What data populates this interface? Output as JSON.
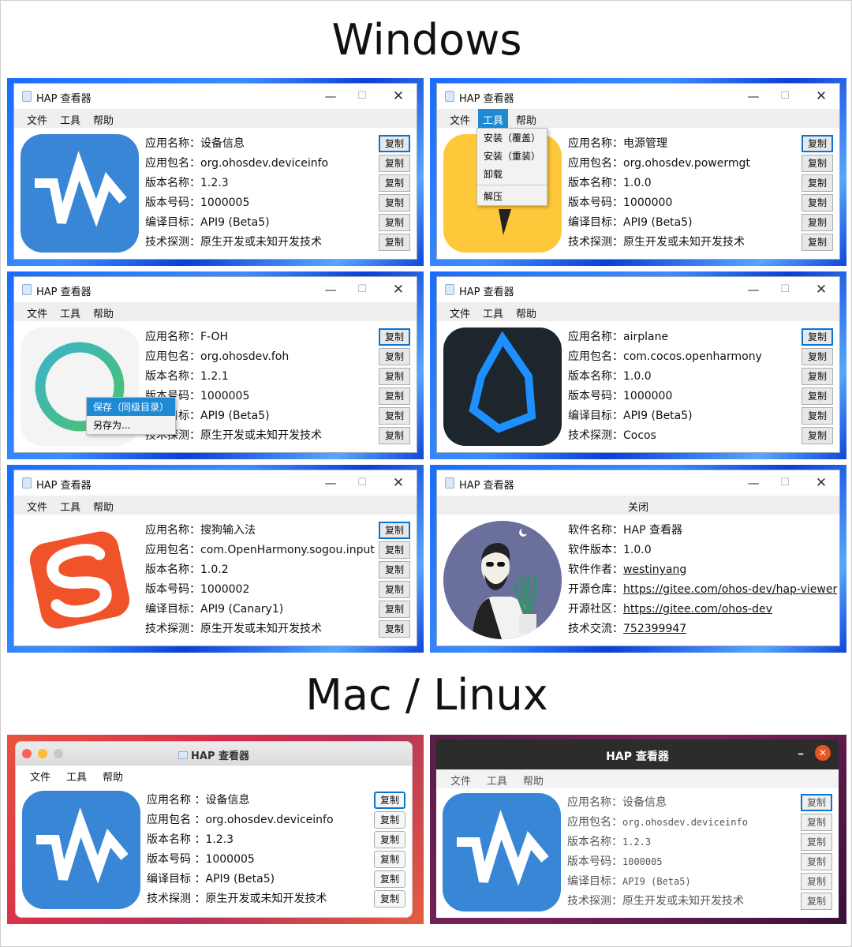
{
  "headings": {
    "windows": "Windows",
    "maclinux": "Mac / Linux"
  },
  "window": {
    "title": "HAP 查看器",
    "menu": [
      "文件",
      "工具",
      "帮助"
    ],
    "copy": "复制"
  },
  "labels": {
    "app_name": "应用名称：",
    "bundle": "应用包名：",
    "version_name": "版本名称：",
    "version_code": "版本号码：",
    "target": "编译目标：",
    "tech": "技术探测：",
    "mac_app_name": "应用名称 ：",
    "mac_bundle": "应用包名 ：",
    "mac_version_name": "版本名称 ：",
    "mac_version_code": "版本号码 ：",
    "mac_target": "编译目标 ：",
    "mac_tech": "技术探测 ："
  },
  "apps": [
    {
      "name": "设备信息",
      "bundle": "org.ohosdev.deviceinfo",
      "version": "1.2.3",
      "code": "1000005",
      "target": "API9 (Beta5)",
      "tech": "原生开发或未知开发技术"
    },
    {
      "name": "电源管理",
      "bundle": "org.ohosdev.powermgt",
      "version": "1.0.0",
      "code": "1000000",
      "target": "API9 (Beta5)",
      "tech": "原生开发或未知开发技术"
    },
    {
      "name": "F-OH",
      "bundle": "org.ohosdev.foh",
      "version": "1.2.1",
      "code": "1000005",
      "target": "API9 (Beta5)",
      "tech": "原生开发或未知开发技术"
    },
    {
      "name": "airplane",
      "bundle": "com.cocos.openharmony",
      "version": "1.0.0",
      "code": "1000000",
      "target": "API9 (Beta5)",
      "tech": "Cocos"
    },
    {
      "name": "搜狗输入法",
      "bundle": "com.OpenHarmony.sogou.input",
      "version": "1.0.2",
      "code": "1000002",
      "target": "API9 (Canary1)",
      "tech": "原生开发或未知开发技术"
    }
  ],
  "tools_menu": [
    "安装（覆盖）",
    "安装（重装）",
    "卸载",
    "解压"
  ],
  "save_menu": [
    "保存（同级目录）",
    "另存为..."
  ],
  "about": {
    "close": "关闭",
    "labels": [
      "软件名称：",
      "软件版本：",
      "软件作者：",
      "开源仓库：",
      "开源社区：",
      "技术交流："
    ],
    "name": "HAP 查看器",
    "version": "1.0.0",
    "author": "westinyang",
    "repo": "https://gitee.com/ohos-dev/hap-viewer",
    "community": "https://gitee.com/ohos-dev",
    "group": "752399947"
  },
  "colors": {
    "accent": "#1f8ad4",
    "deviceinfo_icon": "#3a86d6",
    "powermgt_icon": "#ffc83a",
    "sogou_icon": "#f0522a",
    "ubuntu_close": "#e95420"
  }
}
